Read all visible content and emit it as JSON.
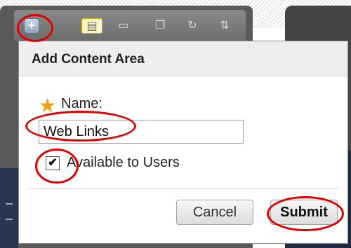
{
  "toolbar": {
    "add_button_icon": "plus-icon",
    "icons": [
      "list-icon",
      "folder-icon",
      "window-icon",
      "refresh-icon",
      "sort-icon"
    ]
  },
  "dialog": {
    "title": "Add Content Area",
    "name_label": "Name:",
    "name_value": "Web Links",
    "checkbox_checked": true,
    "checkbox_mark": "✔",
    "checkbox_label": "Available to Users",
    "cancel_label": "Cancel",
    "submit_label": "Submit"
  },
  "colors": {
    "required_star": "#f39c12",
    "annotation": "#e00000"
  }
}
